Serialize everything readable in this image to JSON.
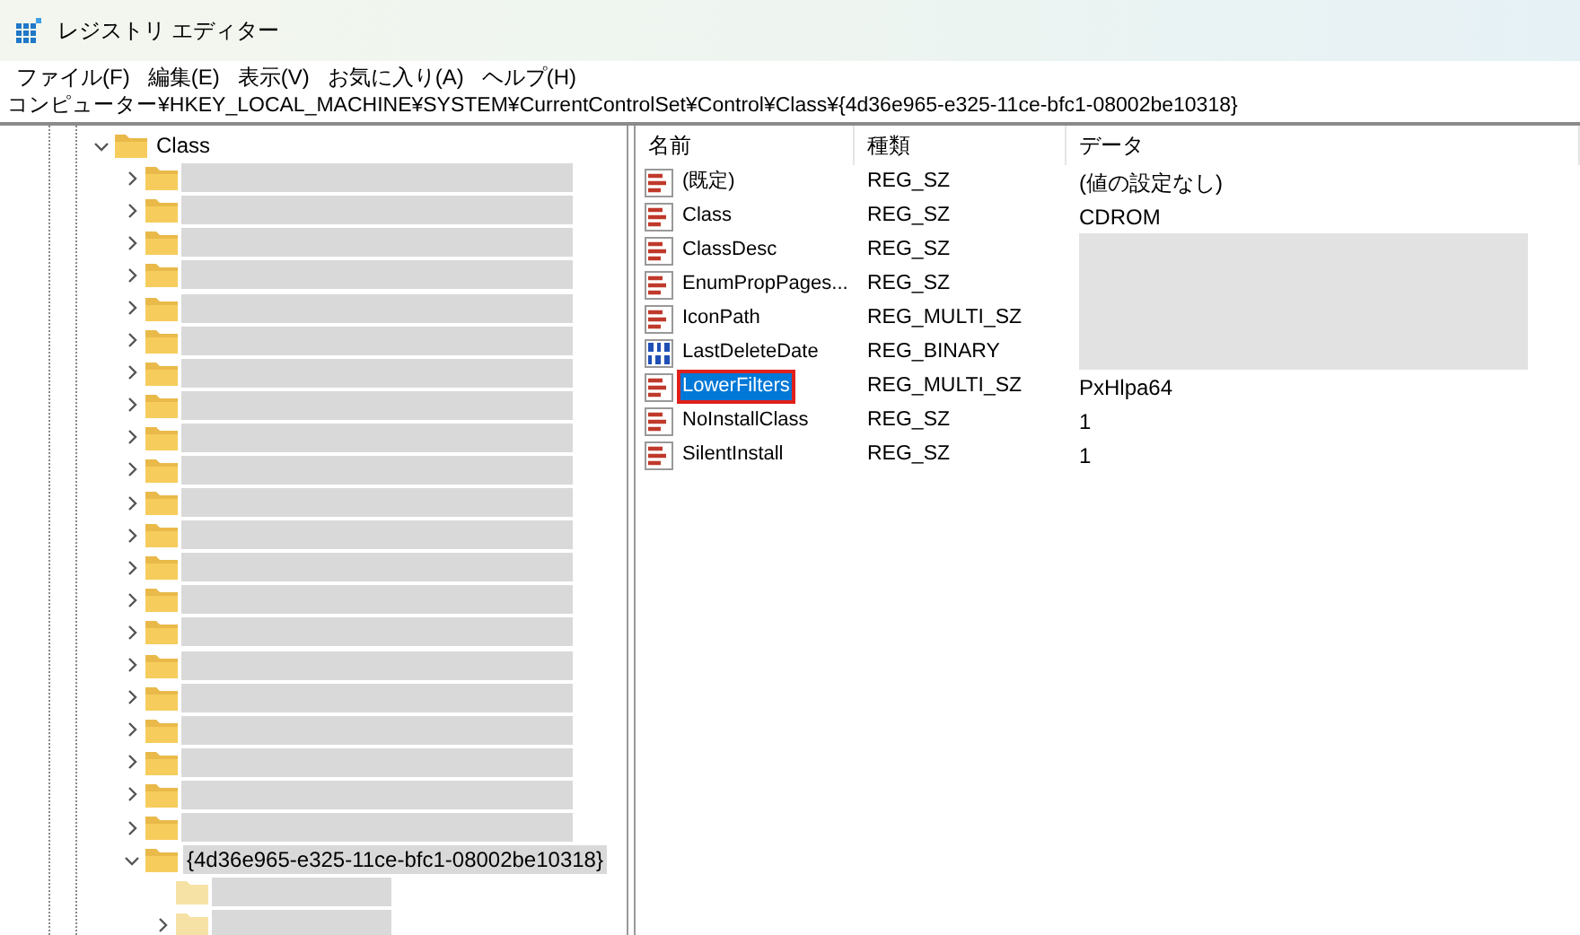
{
  "window": {
    "title": "レジストリ エディター"
  },
  "menu": [
    "ファイル(F)",
    "編集(E)",
    "表示(V)",
    "お気に入り(A)",
    "ヘルプ(H)"
  ],
  "address": "コンピューター¥HKEY_LOCAL_MACHINE¥SYSTEM¥CurrentControlSet¥Control¥Class¥{4d36e965-e325-11ce-bfc1-08002be10318}",
  "tree": {
    "label": "Class",
    "expanded": true,
    "children": [
      {
        "redacted": true,
        "expandable": true
      },
      {
        "redacted": true,
        "expandable": true
      },
      {
        "redacted": true,
        "expandable": true
      },
      {
        "redacted": true,
        "expandable": true
      },
      {
        "redacted": true,
        "expandable": true
      },
      {
        "redacted": true,
        "expandable": true
      },
      {
        "redacted": true,
        "expandable": true
      },
      {
        "redacted": true,
        "expandable": true
      },
      {
        "redacted": true,
        "expandable": true
      },
      {
        "redacted": true,
        "expandable": true
      },
      {
        "redacted": true,
        "expandable": true
      },
      {
        "redacted": true,
        "expandable": true
      },
      {
        "redacted": true,
        "expandable": true
      },
      {
        "redacted": true,
        "expandable": true
      },
      {
        "redacted": true,
        "expandable": true
      },
      {
        "redacted": true,
        "expandable": true
      },
      {
        "redacted": true,
        "expandable": true
      },
      {
        "redacted": true,
        "expandable": true
      },
      {
        "redacted": true,
        "expandable": true
      },
      {
        "redacted": true,
        "expandable": true
      },
      {
        "redacted": true,
        "expandable": true
      },
      {
        "label": "{4d36e965-e325-11ce-bfc1-08002be10318}",
        "selected": true,
        "expanded": true,
        "children": [
          {
            "redacted": true,
            "expandable": false
          },
          {
            "redacted": true,
            "expandable": true
          }
        ]
      }
    ]
  },
  "table": {
    "columns": [
      "名前",
      "種類",
      "データ"
    ],
    "rows": [
      {
        "name": "(既定)",
        "kind": "string",
        "type": "REG_SZ",
        "data": "(値の設定なし)",
        "selected": false
      },
      {
        "name": "Class",
        "kind": "string",
        "type": "REG_SZ",
        "data": "CDROM",
        "selected": false
      },
      {
        "name": "ClassDesc",
        "kind": "string",
        "type": "REG_SZ",
        "redacted": true,
        "selected": false
      },
      {
        "name": "EnumPropPages...",
        "kind": "string",
        "type": "REG_SZ",
        "redacted": true,
        "selected": false
      },
      {
        "name": "IconPath",
        "kind": "string",
        "type": "REG_MULTI_SZ",
        "redacted": true,
        "selected": false
      },
      {
        "name": "LastDeleteDate",
        "kind": "binary",
        "type": "REG_BINARY",
        "redacted": true,
        "selected": false
      },
      {
        "name": "LowerFilters",
        "kind": "string",
        "type": "REG_MULTI_SZ",
        "data": "PxHlpa64",
        "selected": true,
        "highlighted": true
      },
      {
        "name": "NoInstallClass",
        "kind": "string",
        "type": "REG_SZ",
        "data": "1",
        "selected": false
      },
      {
        "name": "SilentInstall",
        "kind": "string",
        "type": "REG_SZ",
        "data": "1",
        "selected": false
      }
    ]
  }
}
